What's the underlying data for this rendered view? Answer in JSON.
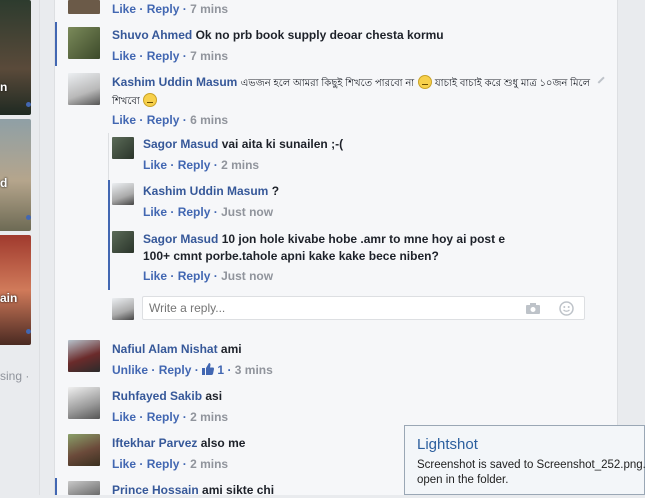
{
  "left_strip": {
    "tile_texts": [
      "n",
      "d",
      "ain"
    ],
    "tail_text": "sing ·"
  },
  "comments": [
    {
      "actions": [
        "Like",
        "Reply"
      ],
      "time": "7 mins"
    },
    {
      "author": "Shuvo Ahmed",
      "text": "Ok no prb book supply deoar chesta kormu",
      "actions": [
        "Like",
        "Reply"
      ],
      "time": "7 mins"
    },
    {
      "author": "Kashim Uddin Masum",
      "text": "এভজন হলে আমরা কিছুই শিখতে পারবো না",
      "text2": "যাচাই বাচাই করে শুধু মাত্র ১০জন মিলে",
      "text3": "শিখবো",
      "actions": [
        "Like",
        "Reply"
      ],
      "time": "6 mins"
    },
    {
      "author": "Nafiul Alam Nishat",
      "text": "ami",
      "actions": [
        "Unlike",
        "Reply"
      ],
      "like_count": "1",
      "time": "3 mins"
    },
    {
      "author": "Ruhfayed Sakib",
      "text": "asi",
      "actions": [
        "Like",
        "Reply"
      ],
      "time": "2 mins"
    },
    {
      "author": "Iftekhar Parvez",
      "text": "also me",
      "actions": [
        "Like",
        "Reply"
      ],
      "time": "2 mins"
    },
    {
      "author": "Prince Hossain",
      "text": "ami sikte chi"
    }
  ],
  "replies": [
    {
      "author": "Sagor Masud",
      "text": "vai aita ki sunailen ;-(",
      "actions": [
        "Like",
        "Reply"
      ],
      "time": "2 mins"
    },
    {
      "author": "Kashim Uddin Masum",
      "text": "?",
      "actions": [
        "Like",
        "Reply"
      ],
      "time": "Just now"
    },
    {
      "author": "Sagor Masud",
      "text": "10 jon hole kivabe hobe .amr to mne hoy ai post e",
      "text2": "100+ cmnt porbe.tahole apni kake kake bece niben?",
      "actions": [
        "Like",
        "Reply"
      ],
      "time": "Just now"
    }
  ],
  "reply_box": {
    "placeholder": "Write a reply..."
  },
  "separator": "·",
  "toast": {
    "title": "Lightshot",
    "line1": "Screenshot is saved to Screenshot_252.png.",
    "line2": "open in the folder."
  },
  "colors": {
    "link": "#365899",
    "action": "#4267b2",
    "muted": "#90949c",
    "accent_bar": "#4267b2"
  }
}
